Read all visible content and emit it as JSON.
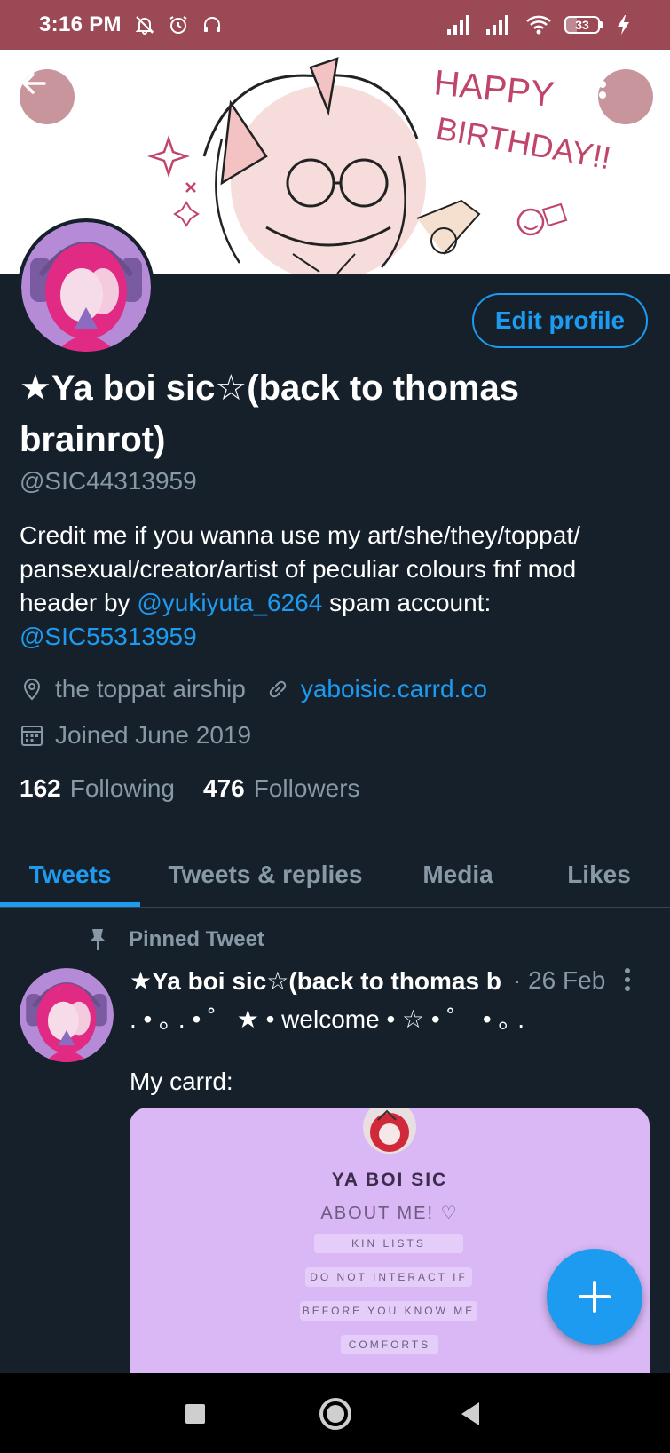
{
  "status_bar": {
    "time": "3:16 PM",
    "battery_level": "33",
    "icons": [
      "mute-icon",
      "alarm-icon",
      "headset-icon",
      "signal-icon",
      "signal-icon",
      "wifi-icon",
      "battery-icon",
      "charging-icon"
    ]
  },
  "banner": {
    "text_line1": "HAPPY",
    "text_line2": "BIRTHDAY!!"
  },
  "profile": {
    "display_name": "★Ya boi sic☆(back to thomas brainrot)",
    "handle": "@SIC44313959",
    "bio_text_1": "Credit me if you wanna use my art/she/they/toppat/ pansexual/creator/artist of peculiar colours fnf mod header by ",
    "bio_mention_1": "@yukiyuta_6264",
    "bio_text_2": " spam account: ",
    "bio_mention_2": "@SIC55313959",
    "location": "the toppat airship",
    "website": "yaboisic.carrd.co",
    "joined": "Joined June 2019",
    "following_count": "162",
    "following_label": "Following",
    "followers_count": "476",
    "followers_label": "Followers",
    "edit_profile_label": "Edit profile"
  },
  "tabs": [
    {
      "label": "Tweets",
      "active": true
    },
    {
      "label": "Tweets & replies",
      "active": false
    },
    {
      "label": "Media",
      "active": false
    },
    {
      "label": "Likes",
      "active": false
    }
  ],
  "pinned_tweet": {
    "pinned_label": "Pinned Tweet",
    "author": "★Ya boi sic☆(back to thomas b...",
    "date": "· 26 Feb",
    "line1": ". • ｡ . • ˚   ★ • welcome • ☆ • ˚    • ｡ .",
    "line2": "My carrd:",
    "card": {
      "title": "YA BOI SIC",
      "about": "ABOUT ME! ♡",
      "pills": [
        "KIN LISTS",
        "DO NOT INTERACT IF",
        "BEFORE YOU KNOW ME",
        "COMFORTS"
      ]
    }
  },
  "colors": {
    "status_bar": "#9b4a55",
    "background": "#15202b",
    "accent": "#1d9bf0",
    "secondary_text": "#8899a6",
    "card_bg": "#d9b8f5"
  }
}
